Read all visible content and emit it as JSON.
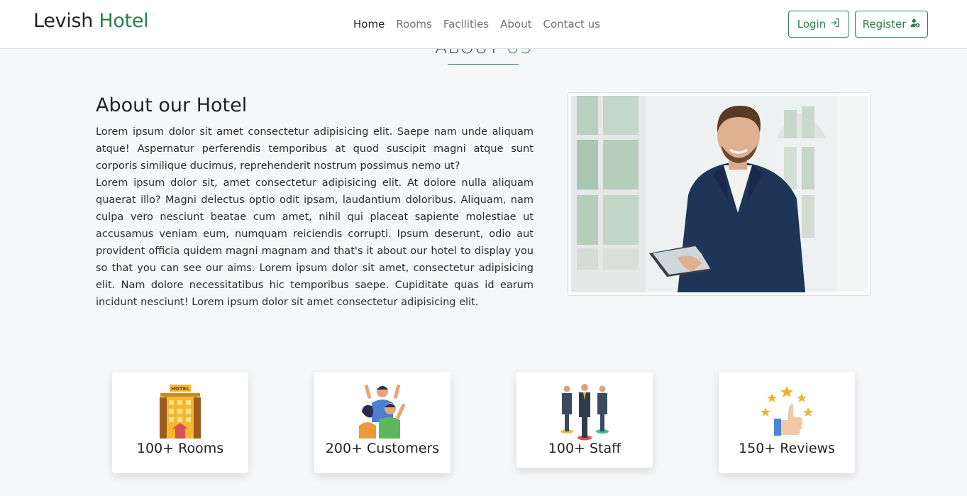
{
  "navbar": {
    "brand_first": "Levish",
    "brand_second": "Hotel",
    "links": [
      "Home",
      "Rooms",
      "Facilities",
      "About",
      "Contact us"
    ],
    "login_label": "Login",
    "register_label": "Register"
  },
  "section": {
    "heading_first": "ABOUT",
    "heading_second": "US"
  },
  "about": {
    "title": "About our Hotel",
    "paragraph1": "Lorem ipsum dolor sit amet consectetur adipisicing elit. Saepe nam unde aliquam atque! Aspernatur perferendis temporibus at quod suscipit magni atque sunt corporis similique ducimus, reprehenderit nostrum possimus nemo ut?",
    "paragraph2": "Lorem ipsum dolor sit, amet consectetur adipisicing elit. At dolore nulla aliquam quaerat illo? Magni delectus optio odit ipsam, laudantium doloribus. Aliquam, nam culpa vero nesciunt beatae cum amet, nihil qui placeat sapiente molestiae ut accusamus veniam eum, numquam reiciendis corrupti. Ipsum deserunt, odio aut provident officia quidem magni magnam and that's it about our hotel to display you so that you can see our aims. Lorem ipsum dolor sit amet, consectetur adipisicing elit. Nam dolore necessitatibus hic temporibus saepe. Cupiditate quas id earum incidunt nesciunt! Lorem ipsum dolor sit amet consectetur adipisicing elit."
  },
  "stats": [
    {
      "label": "100+ Rooms",
      "icon": "hotel-building-icon"
    },
    {
      "label": "200+ Customers",
      "icon": "customers-icon"
    },
    {
      "label": "100+ Staff",
      "icon": "staff-icon"
    },
    {
      "label": "150+ Reviews",
      "icon": "reviews-icon"
    }
  ],
  "hotel_sign_text": "HOTEL",
  "colors": {
    "accent": "#2e7d4f",
    "background": "#f6f7f8"
  }
}
